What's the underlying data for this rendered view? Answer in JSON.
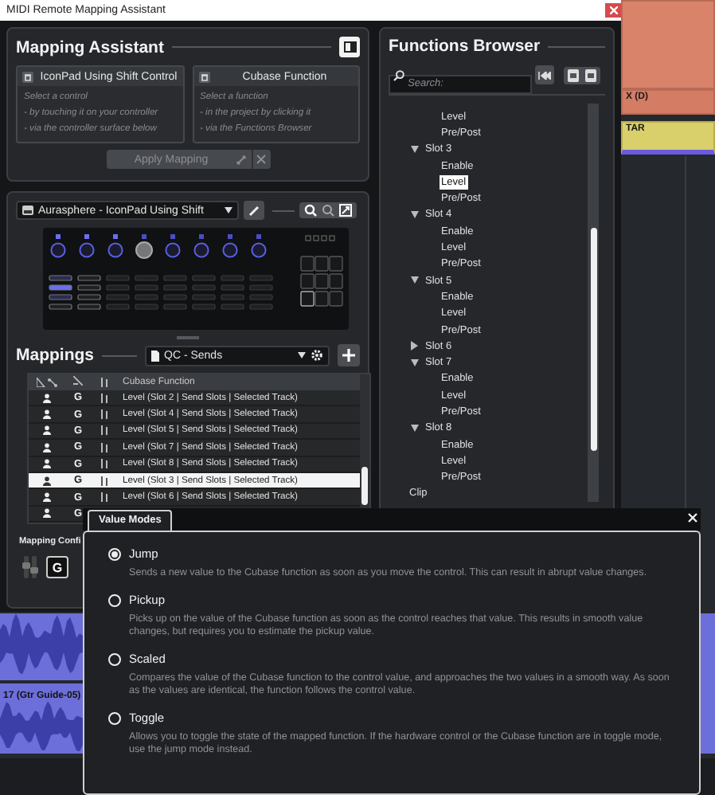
{
  "title_bar": {
    "title": "MIDI Remote Mapping Assistant"
  },
  "mapping_assistant": {
    "title": "Mapping Assistant",
    "cards": [
      {
        "title": "IconPad Using Shift Control",
        "hints": [
          "Select a control",
          "- by touching it on your controller",
          "- via the controller surface below"
        ]
      },
      {
        "title": "Cubase Function",
        "hints": [
          "Select a function",
          "- in the project by clicking it",
          "- via the Functions Browser"
        ]
      }
    ],
    "apply_button": {
      "label": "Apply Mapping",
      "disabled": true
    }
  },
  "controller": {
    "name": "Aurasphere - IconPad Using Shift"
  },
  "mappings": {
    "title": "Mappings",
    "preset": "QC - Sends",
    "function_header": "Cubase Function",
    "rows": [
      {
        "flag": "G",
        "function": "Level (Slot 2 | Send Slots | Selected Track)",
        "selected": false
      },
      {
        "flag": "G",
        "function": "Level (Slot 4 | Send Slots | Selected Track)",
        "selected": false
      },
      {
        "flag": "G",
        "function": "Level (Slot 5 | Send Slots | Selected Track)",
        "selected": false
      },
      {
        "flag": "G",
        "function": "Level (Slot 7 | Send Slots | Selected Track)",
        "selected": false
      },
      {
        "flag": "G",
        "function": "Level (Slot 8 | Send Slots | Selected Track)",
        "selected": false
      },
      {
        "flag": "G",
        "function": "Level (Slot 3 | Send Slots | Selected Track)",
        "selected": true
      },
      {
        "flag": "G",
        "function": "Level (Slot 6 | Send Slots | Selected Track)",
        "selected": false
      },
      {
        "flag": "G",
        "selected": false
      }
    ]
  },
  "mapping_config": {
    "title": "Mapping Confi",
    "button": "G"
  },
  "functions_browser": {
    "title": "Functions Browser",
    "search_placeholder": "Search:",
    "tree": [
      {
        "children": [
          {
            "children": [
              {
                "label": "Level",
                "selected": false
              },
              {
                "label": "Pre/Post",
                "selected": false
              }
            ]
          },
          {
            "label": "Slot 3",
            "selected": false,
            "expanded": true,
            "children": [
              {
                "label": "Enable",
                "selected": false
              },
              {
                "label": "Level",
                "selected": true
              },
              {
                "label": "Pre/Post",
                "selected": false
              }
            ]
          },
          {
            "label": "Slot 4",
            "selected": false,
            "expanded": true,
            "children": [
              {
                "label": "Enable",
                "selected": false
              },
              {
                "label": "Level",
                "selected": false
              },
              {
                "label": "Pre/Post",
                "selected": false
              }
            ]
          },
          {
            "label": "Slot 5",
            "selected": false,
            "expanded": true,
            "children": [
              {
                "label": "Enable",
                "selected": false
              },
              {
                "label": "Level",
                "selected": false
              },
              {
                "label": "Pre/Post",
                "selected": false
              }
            ]
          },
          {
            "label": "Slot 6",
            "selected": false,
            "expanded": false
          },
          {
            "label": "Slot 7",
            "selected": false,
            "expanded": true,
            "children": [
              {
                "label": "Enable",
                "selected": false
              },
              {
                "label": "Level",
                "selected": false
              },
              {
                "label": "Pre/Post",
                "selected": false
              }
            ]
          },
          {
            "label": "Slot 8",
            "selected": false,
            "expanded": true,
            "children": [
              {
                "label": "Enable",
                "selected": false
              },
              {
                "label": "Level",
                "selected": false
              },
              {
                "label": "Pre/Post",
                "selected": false
              }
            ]
          }
        ]
      },
      {
        "label": "Clip",
        "selected": false
      }
    ]
  },
  "value_modes": {
    "title": "Value Modes",
    "options": [
      {
        "label": "Jump",
        "description": "Sends a new value to the Cubase function as soon as you move the control. This can result in abrupt value changes.",
        "selected": true
      },
      {
        "label": "Pickup",
        "description": "Picks up on the value of the Cubase function as soon as the control reaches that value. This results in smooth value changes, but requires you to estimate the pickup value.",
        "selected": false
      },
      {
        "label": "Scaled",
        "description": "Compares the value of the Cubase function to the control value, and approaches the two values in a smooth way. As soon as the values are identical, the function follows the control value.",
        "selected": false
      },
      {
        "label": "Toggle",
        "description": "Allows you to toggle the state of the mapped function. If the hardware control or the Cubase function are in toggle mode, use the jump mode instead.",
        "selected": false
      }
    ]
  },
  "arrangement": {
    "clip_labels": [
      "X (D)",
      "TAR"
    ],
    "lane_label": "17 (Gtr Guide-05)"
  }
}
